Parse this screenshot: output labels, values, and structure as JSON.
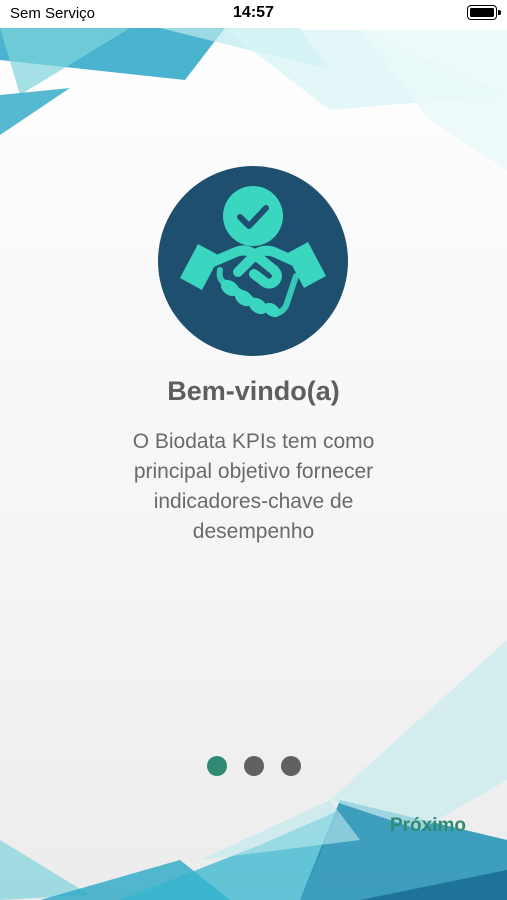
{
  "status_bar": {
    "carrier": "Sem Serviço",
    "time": "14:57",
    "battery_icon": "battery-full-icon"
  },
  "onboarding": {
    "icon": "handshake-check-icon",
    "title": "Bem-vindo(a)",
    "description": "O Biodata KPIs tem como principal objetivo fornecer indicadores-chave de desempenho",
    "pagination": {
      "current": 1,
      "total": 3
    },
    "next_label": "Próximo"
  },
  "colors": {
    "accent": "#2f8a73",
    "icon_circle": "#1f4f6e",
    "icon_fg": "#3ad6c0",
    "dot_inactive": "#616161"
  }
}
